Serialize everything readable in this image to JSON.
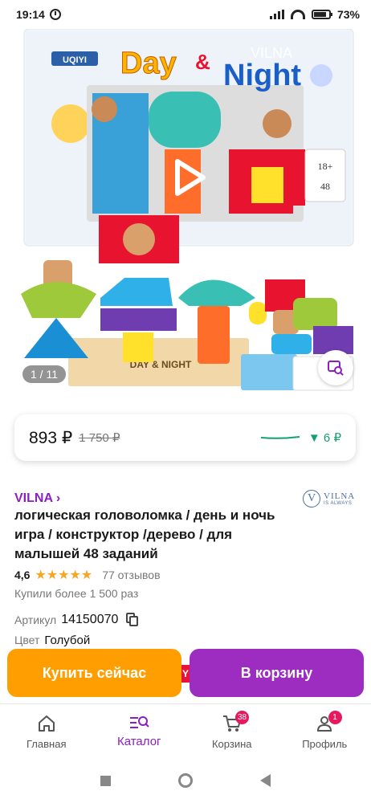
{
  "status_bar": {
    "time": "19:14",
    "battery": "73%"
  },
  "gallery": {
    "box_title_day": "Day",
    "box_title_amp": "&",
    "box_title_night": "Night",
    "box_brand": "UQIYI",
    "watermark": "VILNA",
    "box_age": "18+",
    "box_count": "48",
    "base_text": "DAY & NIGHT",
    "counter": "1 / 11"
  },
  "price": {
    "current": "893 ₽",
    "old": "1 750 ₽",
    "drop": "▼ 6 ₽"
  },
  "brand": {
    "name": "VILNA ›",
    "logo_letter": "V",
    "logo_name": "VILNA",
    "logo_tag": "IS ALWAYS"
  },
  "product": {
    "title": "логическая головоломка / день и ночь игра / конструктор /дерево / для малышей 48 заданий",
    "rating": "4,6",
    "stars": "★★★★★",
    "reviews": "77 отзывов",
    "bought": "Купили более 1 500 раз",
    "article_label": "Артикул",
    "article_value": "14150070",
    "color_label": "Цвет",
    "color_value": "Голубой"
  },
  "actions": {
    "buy_now": "Купить сейчас",
    "add_to_cart": "В корзину",
    "hidden_peek": "Y"
  },
  "nav": {
    "items": [
      {
        "label": "Главная",
        "icon": "home-icon"
      },
      {
        "label": "Каталог",
        "icon": "catalog-search-icon"
      },
      {
        "label": "Корзина",
        "icon": "cart-icon",
        "badge": "38"
      },
      {
        "label": "Профиль",
        "icon": "profile-icon",
        "badge": "1"
      }
    ]
  },
  "colors": {
    "accent": "#8b1fc1",
    "buy": "#ff9e00",
    "cart": "#9c2dc0",
    "drop": "#14a06f",
    "badge": "#e6185e"
  }
}
